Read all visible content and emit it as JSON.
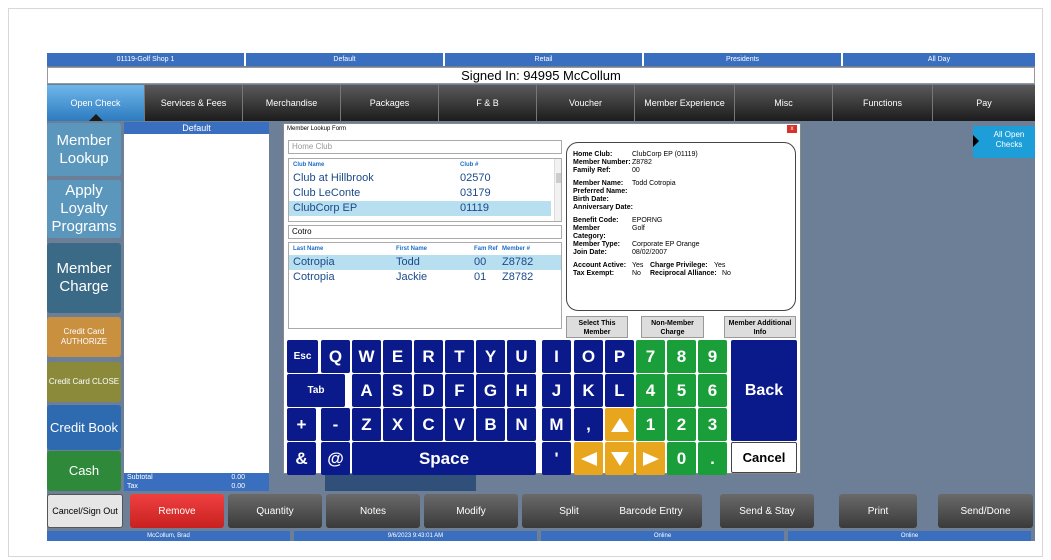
{
  "status_bar": [
    "01119-Golf Shop 1",
    "Default",
    "Retail",
    "Presidents",
    "All Day"
  ],
  "signed_in": "Signed In: 94995 McCollum",
  "tabs": [
    "Open Check",
    "Services & Fees",
    "Merchandise",
    "Packages",
    "F & B",
    "Voucher",
    "Member Experience",
    "Misc",
    "Functions",
    "Pay"
  ],
  "left_buttons": [
    "Member Lookup",
    "Apply Loyalty Programs",
    "Member Charge",
    "Credit Card AUTHORIZE",
    "Credit Card CLOSE",
    "Credit Book",
    "Cash"
  ],
  "check": {
    "header": "Default",
    "subtotal_label": "Subtotal",
    "subtotal": "0.00",
    "tax_label": "Tax",
    "tax": "0.00"
  },
  "all_open_checks": "All Open Checks",
  "modal": {
    "title": "Member Lookup Form",
    "close": "x",
    "home_club_placeholder": "Home Club",
    "club_headers": [
      "Club Name",
      "Club #"
    ],
    "clubs": [
      {
        "name": "Club at Hillbrook",
        "num": "02570"
      },
      {
        "name": "Club LeConte",
        "num": "03179"
      },
      {
        "name": "ClubCorp EP",
        "num": "01119"
      }
    ],
    "search_value": "Cotro",
    "member_headers": [
      "Last Name",
      "First Name",
      "Fam Ref",
      "Member #"
    ],
    "members": [
      {
        "last": "Cotropia",
        "first": "Todd",
        "fam": "00",
        "num": "Z8782"
      },
      {
        "last": "Cotropia",
        "first": "Jackie",
        "fam": "01",
        "num": "Z8782"
      }
    ],
    "info": {
      "home_club_label": "Home Club:",
      "home_club": "ClubCorp EP (01119)",
      "member_number_label": "Member Number:",
      "member_number": "Z8782",
      "family_ref_label": "Family Ref:",
      "family_ref": "00",
      "member_name_label": "Member Name:",
      "member_name": "Todd Cotropia",
      "preferred_name_label": "Preferred Name:",
      "preferred_name": "",
      "birth_date_label": "Birth Date:",
      "birth_date": "",
      "anniversary_label": "Anniversary Date:",
      "anniversary": "",
      "benefit_code_label": "Benefit Code:",
      "benefit_code": "EPORNG",
      "member_category_label": "Member Category:",
      "member_category": "Golf",
      "member_type_label": "Member Type:",
      "member_type": "Corporate EP Orange",
      "join_date_label": "Join Date:",
      "join_date": "08/02/2007",
      "account_active_label": "Account Active:",
      "account_active": "Yes",
      "charge_priv_label": "Charge Privilege:",
      "charge_priv": "Yes",
      "tax_exempt_label": "Tax Exempt:",
      "tax_exempt": "No",
      "reciprocal_label": "Reciprocal Alliance:",
      "reciprocal": "No"
    },
    "buttons": [
      "Select This Member",
      "Non-Member Charge",
      "Member Additional Info"
    ]
  },
  "keyboard": {
    "row1": [
      "Esc",
      "Q",
      "W",
      "E",
      "R",
      "T",
      "Y",
      "U",
      "I",
      "O",
      "P"
    ],
    "row2": [
      "Tab",
      "A",
      "S",
      "D",
      "F",
      "G",
      "H",
      "J",
      "K",
      "L"
    ],
    "row3": [
      "+",
      "-",
      "Z",
      "X",
      "C",
      "V",
      "B",
      "N",
      "M",
      ","
    ],
    "row4": [
      "&",
      "@",
      "Space",
      "'"
    ],
    "numpad": [
      "7",
      "8",
      "9",
      "4",
      "5",
      "6",
      "1",
      "2",
      "3",
      "0",
      "."
    ],
    "back": "Back",
    "cancel": "Cancel"
  },
  "bottom_buttons": [
    "Cancel/Sign Out",
    "Remove",
    "Quantity",
    "Notes",
    "Modify",
    "Split",
    "Barcode Entry",
    "Send & Stay",
    "Print",
    "Send/Done"
  ],
  "footer": [
    "McCollum, Brad",
    "9/6/2023 9:43:01 AM",
    "Online",
    "Online"
  ],
  "colors": {
    "accent": "#3a6fc0",
    "green_key": "#1a9e3a",
    "yellow_key": "#e8a61f",
    "key_blue": "#0a1a8a",
    "remove": "#e03030"
  }
}
